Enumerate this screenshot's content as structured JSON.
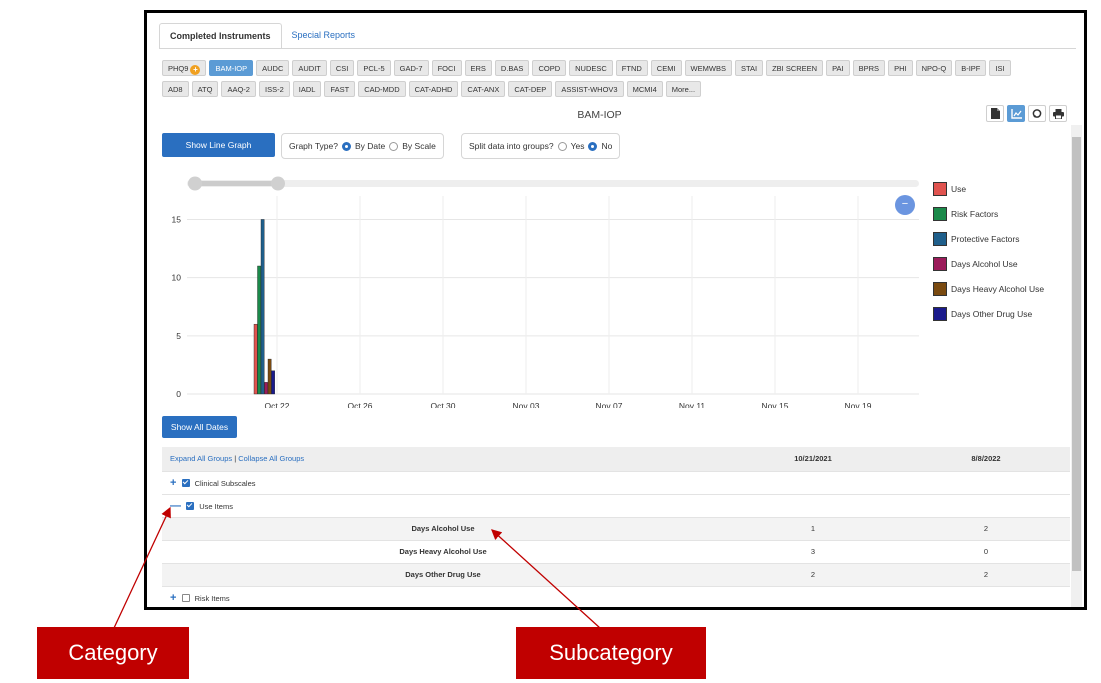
{
  "tabs": {
    "completed": "Completed Instruments",
    "special": "Special Reports"
  },
  "instruments_row1": [
    "PHQ9",
    "BAM-IOP",
    "AUDC",
    "AUDIT",
    "CSI",
    "PCL-5",
    "GAD-7",
    "FOCI",
    "ERS",
    "D.BAS",
    "COPD",
    "NUDESC",
    "FTND",
    "CEMI",
    "WEMWBS",
    "STAI",
    "ZBI SCREEN",
    "PAI",
    "BPRS",
    "PHI",
    "NPO-Q",
    "B-IPF",
    "ISI"
  ],
  "instruments_row2": [
    "AD8",
    "ATQ",
    "AAQ-2",
    "ISS-2",
    "IADL",
    "FAST",
    "CAD-MDD",
    "CAT-ADHD",
    "CAT-ANX",
    "CAT-DEP",
    "ASSIST-WHOV3",
    "MCMI4",
    "More..."
  ],
  "selected_instrument": "BAM-IOP",
  "phq9_badge": "+",
  "chart_title": "BAM-IOP",
  "toolbar_icons": [
    "document-icon",
    "chart-icon",
    "comment-icon",
    "print-icon"
  ],
  "controls": {
    "show_line_graph": "Show Line Graph",
    "graph_type_label": "Graph Type?",
    "by_date": "By Date",
    "by_scale": "By Scale",
    "split_label": "Split data into groups?",
    "yes": "Yes",
    "no": "No",
    "graph_type_selected": "By Date",
    "split_selected": "No",
    "show_all_dates": "Show All Dates",
    "zoom_button": "−"
  },
  "chart_data": {
    "type": "bar",
    "x_ticks": [
      "Oct 22",
      "Oct 26",
      "Oct 30",
      "Nov 03",
      "Nov 07",
      "Nov 11",
      "Nov 15",
      "Nov 19"
    ],
    "y_ticks": [
      "0",
      "5",
      "10",
      "15"
    ],
    "ylim": [
      0,
      16.5
    ],
    "grid": true,
    "legend_position": "right",
    "categories": [
      "Oct 21"
    ],
    "series": [
      {
        "name": "Use",
        "color": "#e0534f",
        "values": [
          6
        ]
      },
      {
        "name": "Risk Factors",
        "color": "#1b8a4a",
        "values": [
          11
        ]
      },
      {
        "name": "Protective Factors",
        "color": "#1f5f8b",
        "values": [
          15
        ]
      },
      {
        "name": "Days Alcohol Use",
        "color": "#9b1b5a",
        "values": [
          1
        ]
      },
      {
        "name": "Days Heavy Alcohol Use",
        "color": "#7a4a10",
        "values": [
          3
        ]
      },
      {
        "name": "Days Other Drug Use",
        "color": "#1a1a8c",
        "values": [
          2
        ]
      }
    ]
  },
  "table": {
    "expand_all": "Expand All Groups",
    "separator": "|",
    "collapse_all": "Collapse All Groups",
    "dates": [
      "10/21/2021",
      "8/8/2022"
    ],
    "groups": [
      {
        "toggle": "+",
        "label": "Clinical Subscales",
        "checked": true
      },
      {
        "toggle": "—",
        "label": "Use Items",
        "checked": true
      },
      {
        "toggle": "+",
        "label": "Risk Items",
        "checked": false
      }
    ],
    "rows": [
      {
        "label": "Days Alcohol Use",
        "values": [
          "1",
          "2"
        ]
      },
      {
        "label": "Days Heavy Alcohol Use",
        "values": [
          "3",
          "0"
        ]
      },
      {
        "label": "Days Other Drug Use",
        "values": [
          "2",
          "2"
        ]
      }
    ]
  },
  "annotations": {
    "category": "Category",
    "subcategory": "Subcategory"
  },
  "colors": {
    "accent": "#2a6fc0",
    "callout": "#c00000"
  }
}
